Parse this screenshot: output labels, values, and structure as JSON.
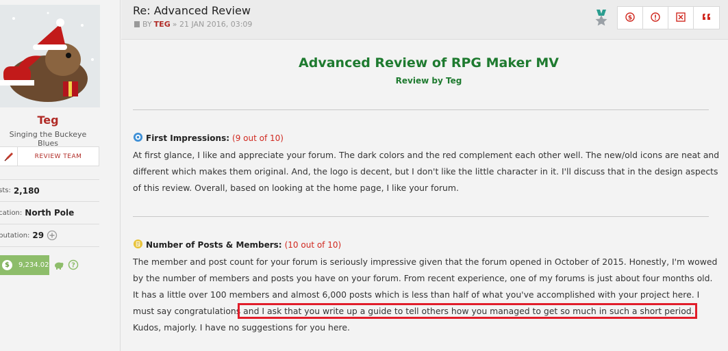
{
  "author": {
    "name": "Teg",
    "title": "Singing the Buckeye Blues",
    "badge_label": "REVIEW TEAM",
    "stats": {
      "posts_label": "osts:",
      "posts_value": "2,180",
      "location_label": "ocation:",
      "location_value": "North Pole",
      "reputation_label": "eputation:",
      "reputation_value": "29"
    },
    "money": "9,234.02"
  },
  "post": {
    "title": "Re: Advanced Review",
    "meta_by": "BY",
    "meta_author": "TEG",
    "meta_date": "» 21 JAN 2016, 03:09",
    "heading": "Advanced Review of RPG Maker MV",
    "subheading": "Review by Teg",
    "sections": [
      {
        "label": "First Impressions:",
        "score": "(9 out of 10)",
        "text": "At first glance, I like and appreciate your forum. The dark colors and the red complement each other well. The new/old icons are neat and different which makes them original. And, the logo is decent, but I don't like the little character in it. I'll discuss that in the design aspects of this review. Overall, based on looking at the home page, I like your forum."
      },
      {
        "label": "Number of Posts & Members:",
        "score": "(10 out of 10)",
        "text_before": "The member and post count for your forum is seriously impressive given that the forum opened in October of 2015. Honestly, I'm wowed by the number of members and posts you have on your forum. From recent experience, one of my forums is just about four months old. It has a little over 100 members and almost 6,000 posts which is less than half of what you've accomplished with your project here. I must say congratulations",
        "text_highlight": " and I ask that you write up a guide to tell others how you managed to get so much in such a short period.",
        "text_after": " Kudos, majorly. I have no suggestions for you here."
      }
    ]
  },
  "icons": {
    "badge": "pen-icon",
    "medal": "medal-icon",
    "actions": [
      "dollar-icon",
      "report-icon",
      "delete-icon",
      "quote-icon"
    ],
    "section1": "gear-icon",
    "section2": "note-icon"
  },
  "colors": {
    "accent_red": "#b02a25",
    "heading_green": "#1e7a2f",
    "score_red": "#d0281f",
    "highlight_box": "#e11d2a",
    "money_green": "#8dbd6a"
  }
}
